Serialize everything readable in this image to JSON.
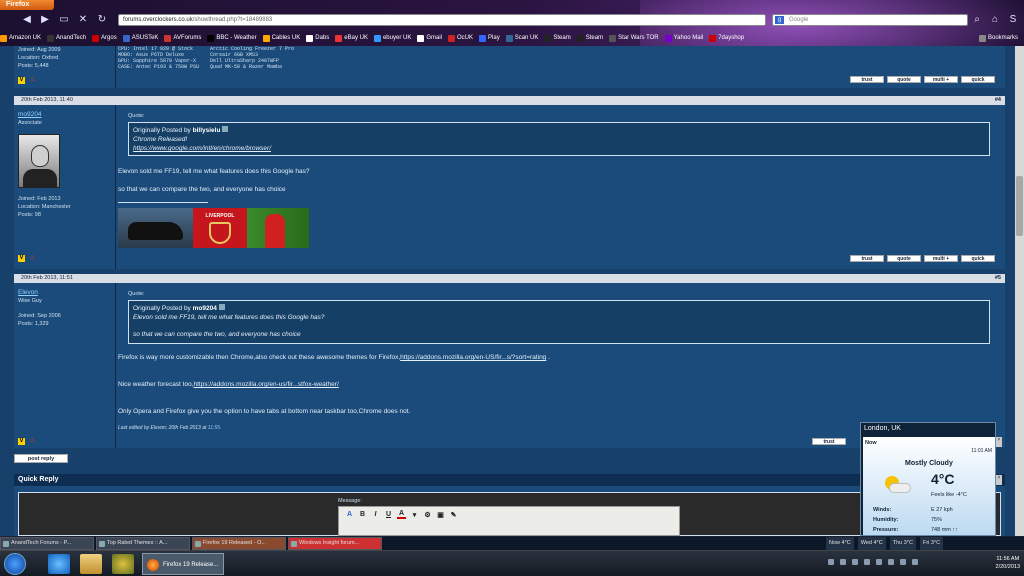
{
  "browser": {
    "app_button": "Firefox",
    "url_domain": "forums.overclockers.co.uk",
    "url_path": "/showthread.php?t=18489883",
    "search_placeholder": "Google",
    "bookmarks": [
      "Amazon UK",
      "AnandTech",
      "Argos",
      "ASUSTeK",
      "AVForums",
      "BBC - Weather",
      "Cables UK",
      "Dabs",
      "eBay UK",
      "ebuyer UK",
      "Gmail",
      "OcUK",
      "Play",
      "Scan UK",
      "Steam",
      "Steam",
      "Star Wars TOR",
      "Yahoo Mail",
      "7dayshop"
    ],
    "bookmarks_menu": "Bookmarks"
  },
  "post0": {
    "joined": "Joined: Aug 2009",
    "location": "Location: Oxford",
    "posts": "Posts: 5,448",
    "spec_left": [
      "CPU: Intel i7 920 @ Stock",
      "MOBO: Asus P6TD Deluxe",
      "GPU: Sapphire 5870 Vapor-X",
      "CASE: Antec P193 & 750W PSU"
    ],
    "spec_right": [
      "Arctic Cooling Freezer 7 Pro",
      "Corsair 6GB XMS3",
      "Dell UltraSharp 2407WFP",
      "Quad MK-50 & Razer Mamba"
    ]
  },
  "buttons": {
    "trust": "trust",
    "quote": "quote",
    "multi": "multi +",
    "quick": "quick"
  },
  "post1": {
    "date": "20th Feb 2013, 11:40",
    "num": "#4",
    "username": "mo9204",
    "title": "Associate",
    "joined": "Joined: Feb 2013",
    "location": "Location: Manchester",
    "posts": "Posts: 98",
    "quote_label": "Quote:",
    "quote_by": "Originally Posted by",
    "quote_user": "billysielu",
    "quote_line1": "Chrome Released!",
    "quote_link": "https://www.google.com/intl/en/chrome/browser/",
    "text1": "Elevon sold me FF19, tell me what features does this Google has?",
    "text2": "so that we can compare the two, and everyone has choice",
    "sig_club": "LIVERPOOL"
  },
  "post2": {
    "date": "20th Feb 2013, 11:51",
    "num": "#5",
    "username": "Elevon",
    "title": "Wise Guy",
    "joined": "Joined: Sep 2006",
    "posts": "Posts: 1,329",
    "quote_label": "Quote:",
    "quote_by": "Originally Posted by",
    "quote_user": "mo9204",
    "quote_line1": "Elevon sold me FF19, tell me what features does this Google has?",
    "quote_line2": "so that we can compare the two, and everyone has choice",
    "text1": "Firefox is way more customizable then Chrome,also check out these awesome themes for Firefox,",
    "link1": "https://addons.mozilla.org/en-US/fir...s/?sort=rating",
    "text1_end": ".",
    "text2": "Nice weather forecast too,",
    "link2": "https://addons.mozilla.org/en-us/fir...stfox-weather/",
    "text3": "Only Opera and Firefox give you the option to have tabs at bottom near taskbar too,Chrome does not.",
    "edited_prefix": "Last edited by Elevon; 20th Feb 2013 at",
    "edited_time": "11:55",
    "edited_suffix": "."
  },
  "post_reply": "post reply",
  "quick_reply": "Quick Reply",
  "message_label": "Message:",
  "editor_tools": [
    "A",
    "B",
    "I",
    "U",
    "A",
    "▾",
    "⚙",
    "▣",
    "✎"
  ],
  "weather": {
    "location": "London, UK",
    "now": "Now",
    "time": "11:01 AM",
    "condition": "Mostly Cloudy",
    "temp": "4°C",
    "feels": "Feels like -4°C",
    "winds_label": "Winds:",
    "winds": "E 27 kph",
    "humidity_label": "Humidity:",
    "humidity": "75%",
    "pressure_label": "Pressure:",
    "pressure": "748 mm ↑↑"
  },
  "tabs": [
    "AnandTech Forums - P...",
    "Top Rated Themes :: A...",
    "Firefox 19 Released - O...",
    "Windows Insight forum..."
  ],
  "forecast": [
    "Now 4°C",
    "Wed 4°C",
    "Thu 3°C",
    "Fri 3°C"
  ],
  "taskbar": {
    "firefox_window": "Firefox 19 Release...",
    "clock_time": "11:56 AM",
    "clock_date": "2/20/2013"
  }
}
